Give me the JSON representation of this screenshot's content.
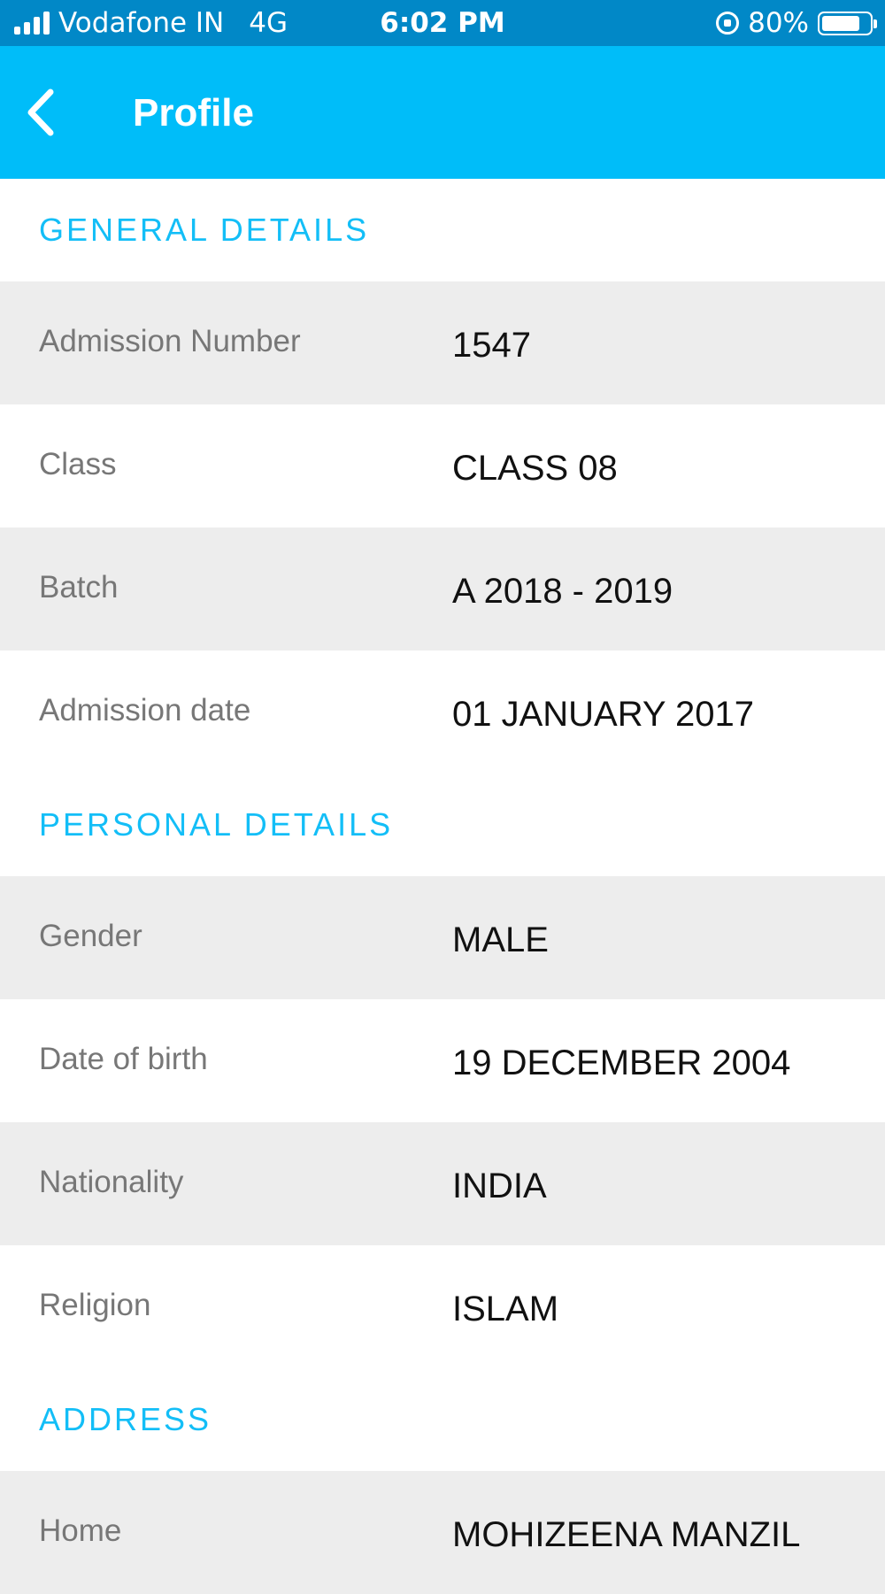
{
  "status_bar": {
    "carrier": "Vodafone IN",
    "network": "4G",
    "time": "6:02 PM",
    "battery_percent": "80%",
    "battery_level": 0.8
  },
  "header": {
    "title": "Profile",
    "back_icon": "chevron-left-icon"
  },
  "sections": {
    "general": {
      "title": "GENERAL DETAILS",
      "rows": [
        {
          "label": "Admission Number",
          "value": "1547"
        },
        {
          "label": "Class",
          "value": "CLASS 08"
        },
        {
          "label": "Batch",
          "value": "A 2018 - 2019"
        },
        {
          "label": "Admission date",
          "value": "01 JANUARY 2017"
        }
      ]
    },
    "personal": {
      "title": "PERSONAL DETAILS",
      "rows": [
        {
          "label": "Gender",
          "value": "MALE"
        },
        {
          "label": "Date of birth",
          "value": "19 DECEMBER 2004"
        },
        {
          "label": "Nationality",
          "value": "INDIA"
        },
        {
          "label": "Religion",
          "value": "ISLAM"
        }
      ]
    },
    "address": {
      "title": "ADDRESS",
      "rows": [
        {
          "label": "Home",
          "value": "MOHIZEENA MANZIL"
        }
      ]
    }
  },
  "colors": {
    "status_bar": "#0188c7",
    "app_bar": "#00bdf9",
    "section_title": "#13bef7",
    "row_alt": "#ededed"
  }
}
